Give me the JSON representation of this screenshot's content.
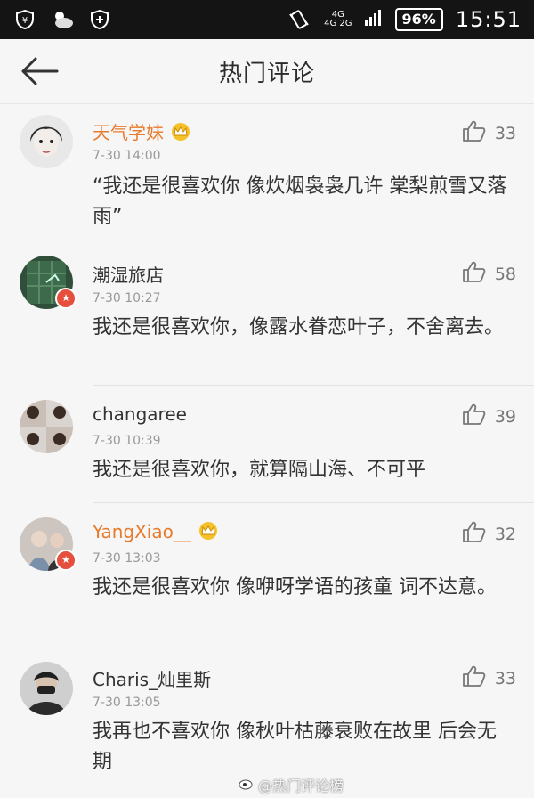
{
  "statusbar": {
    "icons_left": [
      "weibo-shield-icon",
      "weather-icon",
      "shield-plus-icon"
    ],
    "net_top": "4G",
    "net_bottom": "4G 2G",
    "battery": "96%",
    "clock": "15:51"
  },
  "header": {
    "title": "热门评论",
    "back_icon": "arrow-left-icon"
  },
  "comments": [
    {
      "name": "天气学妹",
      "vip": true,
      "verified": false,
      "time": "7-30 14:00",
      "likes": "33",
      "text": "“我还是很喜欢你 像炊烟袅袅几许 棠梨煎雪又落雨”"
    },
    {
      "name": "潮湿旅店",
      "vip": false,
      "verified": true,
      "time": "7-30 10:27",
      "likes": "58",
      "text": "我还是很喜欢你，像露水眷恋叶子，不舍离去。"
    },
    {
      "name": "changaree",
      "vip": false,
      "verified": false,
      "time": "7-30 10:39",
      "likes": "39",
      "text": "我还是很喜欢你，就算隔山海、不可平"
    },
    {
      "name": "YangXiao__",
      "vip": true,
      "verified": true,
      "time": "7-30 13:03",
      "likes": "32",
      "text": "我还是很喜欢你 像咿呀学语的孩童 词不达意。"
    },
    {
      "name": "Charis_灿里斯",
      "vip": false,
      "verified": false,
      "time": "7-30 13:05",
      "likes": "33",
      "text": "我再也不喜欢你 像秋叶枯藤衰败在故里 后会无期"
    }
  ],
  "watermark": "@热门评论榜"
}
